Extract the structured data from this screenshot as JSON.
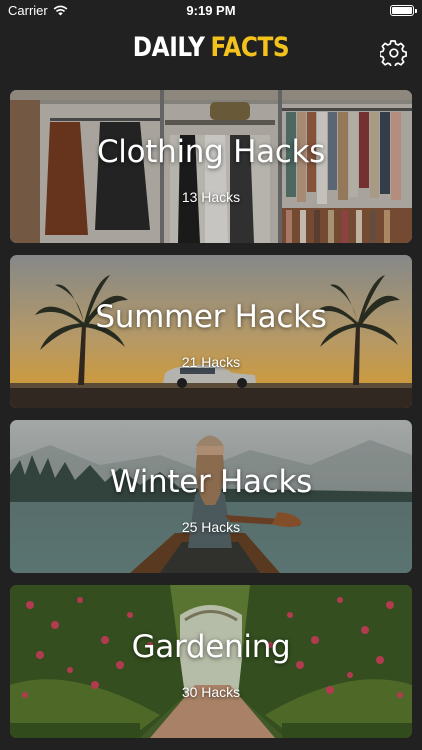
{
  "status_bar": {
    "carrier": "Carrier",
    "time": "9:19 PM",
    "battery_level": 1.0
  },
  "header": {
    "title_part1": "DAILY",
    "title_part2": "FACTS",
    "accent_color": "#f4c21c",
    "settings_icon": "gear-icon"
  },
  "categories": [
    {
      "title": "Clothing Hacks",
      "count": "13 Hacks",
      "theme": "clothing"
    },
    {
      "title": "Summer Hacks",
      "count": "21 Hacks",
      "theme": "summer"
    },
    {
      "title": "Winter Hacks",
      "count": "25 Hacks",
      "theme": "winter"
    },
    {
      "title": "Gardening",
      "count": "30 Hacks",
      "theme": "garden"
    }
  ]
}
